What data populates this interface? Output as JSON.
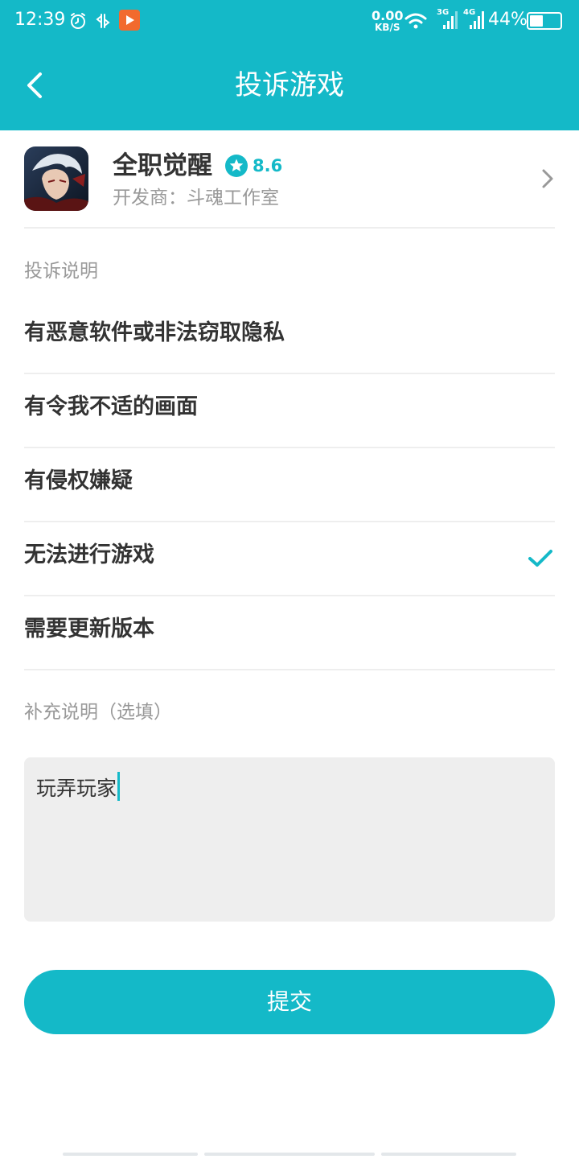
{
  "colors": {
    "accent": "#14b9c8",
    "text_primary": "#333333",
    "text_secondary": "#999999",
    "divider": "#eeeeee",
    "input_background": "#eeeeee"
  },
  "status_bar": {
    "time": "12:39",
    "icons": [
      "alarm-icon",
      "data-sync-icon",
      "app-notification-icon",
      "wifi-icon",
      "signal-3g-icon",
      "signal-4g-icon",
      "battery-icon"
    ],
    "net_speed_value": "0.00",
    "net_speed_unit": "KB/S",
    "sig1_label": "3G",
    "sig2_label": "4G",
    "battery_text": "44%",
    "battery_level": 0.44
  },
  "header": {
    "title": "投诉游戏",
    "back_icon": "chevron-left-icon"
  },
  "game": {
    "name": "全职觉醒",
    "rating": "8.6",
    "rating_icon": "star-icon",
    "developer": "开发商：斗魂工作室"
  },
  "complaint": {
    "section_label": "投诉说明",
    "options": [
      {
        "label": "有恶意软件或非法窃取隐私",
        "selected": false
      },
      {
        "label": "有令我不适的画面",
        "selected": false
      },
      {
        "label": "有侵权嫌疑",
        "selected": false
      },
      {
        "label": "无法进行游戏",
        "selected": true
      },
      {
        "label": "需要更新版本",
        "selected": false
      }
    ]
  },
  "supplement": {
    "label": "补充说明（选填）",
    "value": "玩弄玩家"
  },
  "submit": {
    "label": "提交"
  }
}
